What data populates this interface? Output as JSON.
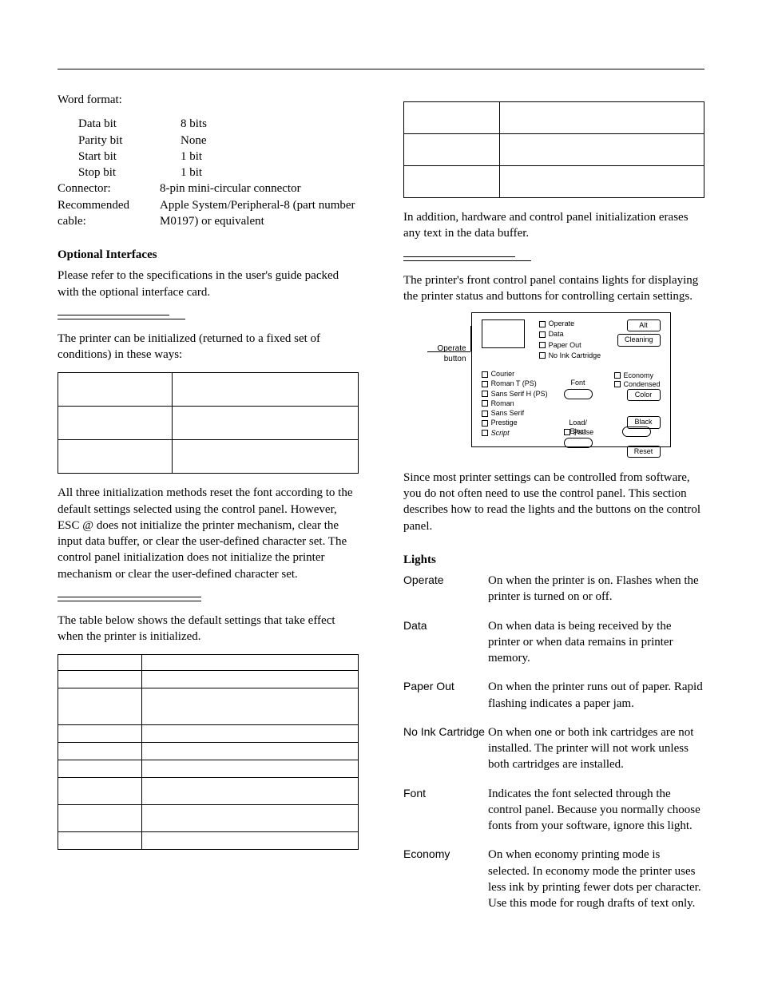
{
  "left": {
    "word_format_heading": "Word format:",
    "wf": [
      {
        "k": "Data bit",
        "v": "8 bits"
      },
      {
        "k": "Parity bit",
        "v": "None"
      },
      {
        "k": "Start bit",
        "v": "1 bit"
      },
      {
        "k": "Stop bit",
        "v": "1 bit"
      }
    ],
    "connector": {
      "k": "Connector:",
      "v": "8-pin mini-circular connector"
    },
    "cable": {
      "k": "Recommended cable:",
      "v": "Apple System/Peripheral-8 (part number M0197) or equivalent"
    },
    "optional_heading": "Optional Interfaces",
    "optional_text": "Please refer to the specifications in the user's guide packed with the optional interface card.",
    "init_intro": "The printer can be initialized (returned to a fixed set of conditions) in these ways:",
    "init_note": "All three initialization methods reset the font according to the default settings selected using the control panel. However, ESC @ does not initialize the printer mechanism, clear the input data buffer, or clear the user-defined character set. The control panel initialization does not initialize the printer mechanism or clear the user-defined character set.",
    "defaults_intro": "The table below shows the default settings that take effect when the printer is initialized."
  },
  "right": {
    "buffer_note": "In addition, hardware and control panel initialization erases any text in the data buffer.",
    "panel_intro": "The printer's front control panel contains lights for displaying the printer status and buttons for controlling certain settings.",
    "panel": {
      "callout": "Operate\nbutton",
      "status": [
        "Operate",
        "Data",
        "Paper Out",
        "No Ink Cartridge"
      ],
      "fonts": [
        "Courier",
        "Roman T (PS)",
        "Sans Serif H (PS)",
        "Roman",
        "Sans Serif",
        "Prestige",
        "Script"
      ],
      "right_btns": [
        "Alt",
        "Cleaning",
        "Color",
        "Black",
        "Reset"
      ],
      "econ": [
        "Economy",
        "Condensed"
      ],
      "mid": [
        "Font",
        "Load/\nEject"
      ],
      "pause": "Pause"
    },
    "panel_note": "Since most printer settings can be controlled from software, you do not often need to use the control panel. This section describes how to read the lights and the buttons on the control panel.",
    "lights_heading": "Lights",
    "lights": [
      {
        "t": "Operate",
        "d": "On when the printer is on. Flashes when the printer is turned on or off."
      },
      {
        "t": "Data",
        "d": "On when data is being received by the printer or when data remains in printer memory."
      },
      {
        "t": "Paper Out",
        "d": "On when the printer runs out of paper. Rapid flashing indicates a paper jam."
      },
      {
        "t": "No Ink Cartridge",
        "d": "On when one or both ink cartridges are not installed. The printer will not work unless both cartridges are installed."
      },
      {
        "t": "Font",
        "d": "Indicates the font selected through the control panel. Because you normally choose fonts from your software, ignore this light."
      },
      {
        "t": "Economy",
        "d": "On when economy printing mode is selected. In economy mode the printer uses less ink by printing fewer dots per character. Use this mode for rough drafts of text only."
      }
    ]
  }
}
